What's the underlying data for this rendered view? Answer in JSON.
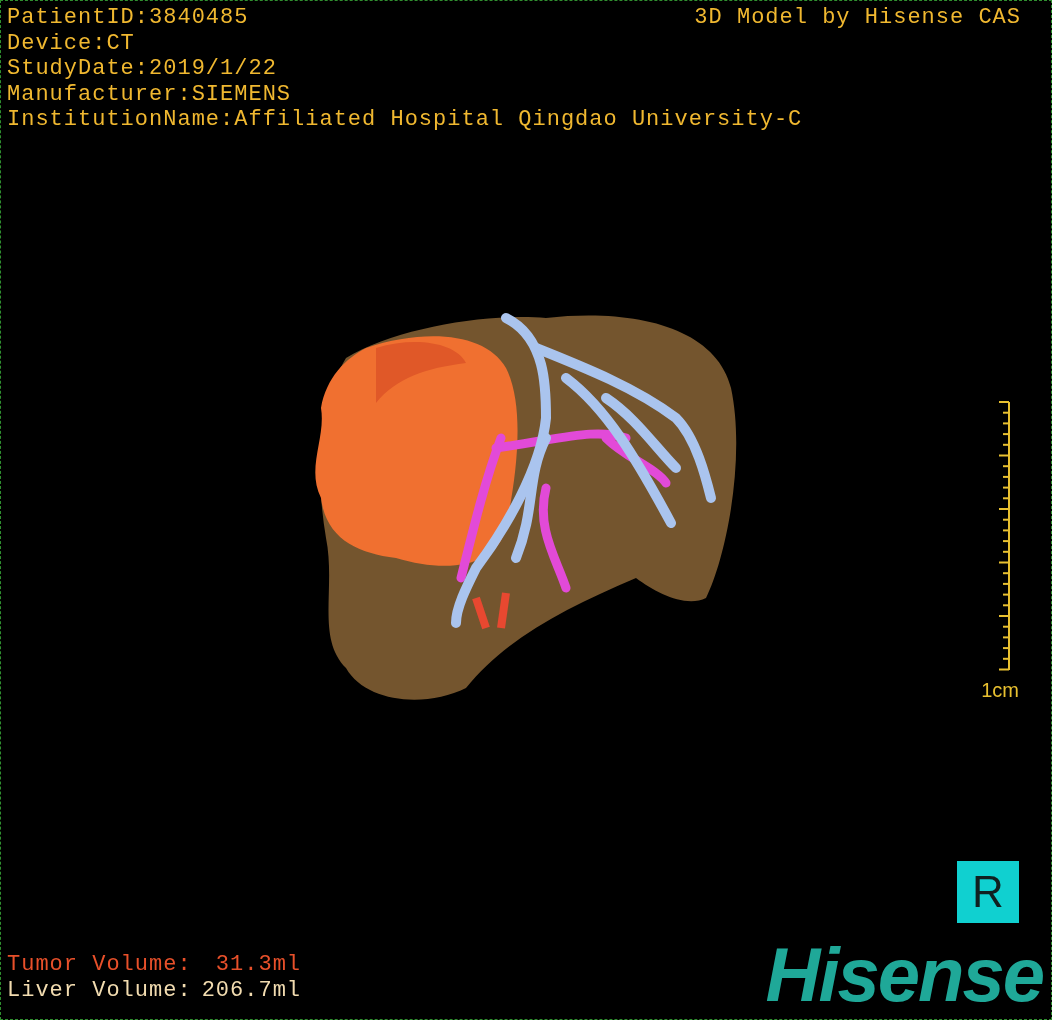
{
  "header": {
    "info": [
      "PatientID:3840485",
      "Device:CT",
      "StudyDate:2019/1/22",
      "Manufacturer:SIEMENS",
      "InstitutionName:Affiliated Hospital Qingdao University-C"
    ],
    "credit": "3D Model by Hisense CAS"
  },
  "scale_bar": {
    "label": "1cm"
  },
  "orientation_marker": "R",
  "volumes": [
    {
      "label": "Tumor Volume:",
      "value": "31.3ml",
      "color": "#e8502a"
    },
    {
      "label": "Liver Volume:",
      "value": "206.7ml",
      "color": "#f2dcb0"
    }
  ],
  "logo": "Hisense"
}
